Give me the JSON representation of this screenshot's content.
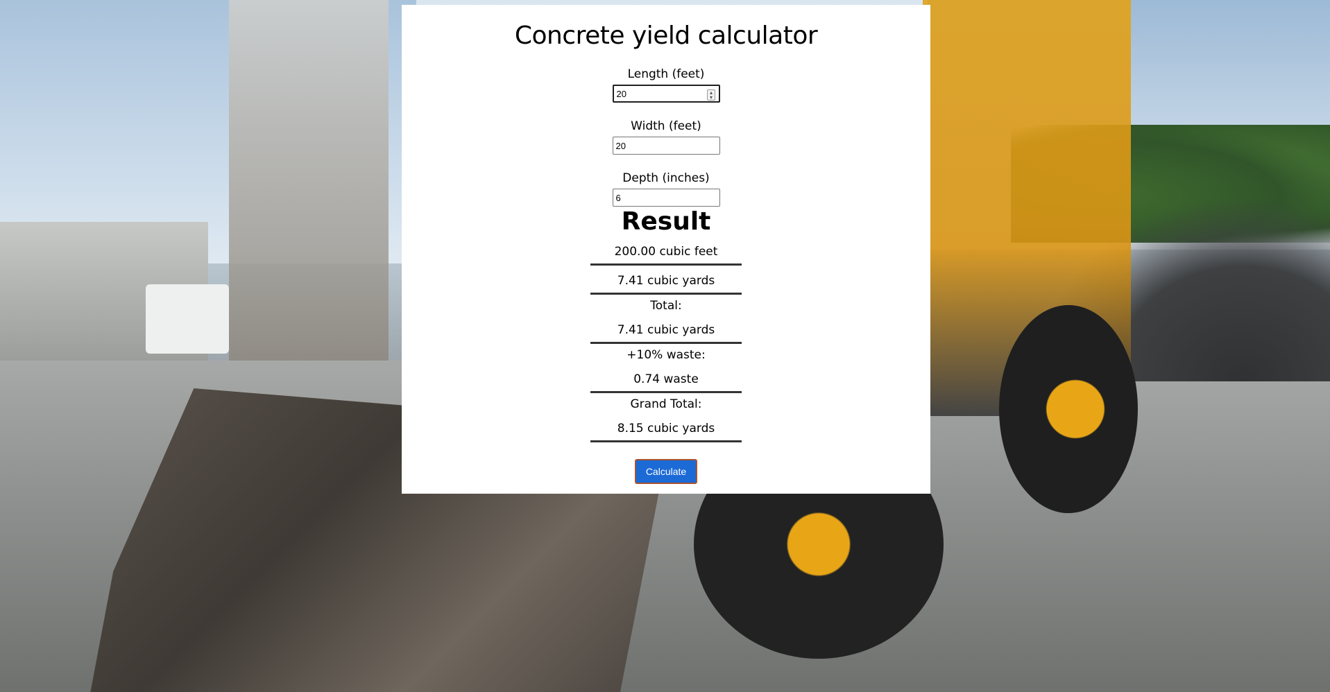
{
  "page": {
    "title": "Concrete yield calculator"
  },
  "inputs": {
    "length": {
      "label": "Length (feet)",
      "value": "20"
    },
    "width": {
      "label": "Width (feet)",
      "value": "20"
    },
    "depth": {
      "label": "Depth (inches)",
      "value": "6"
    }
  },
  "result": {
    "heading": "Result",
    "cubic_feet": "200.00 cubic feet",
    "cubic_yards": "7.41 cubic yards",
    "total_label": "Total:",
    "total_value": "7.41 cubic yards",
    "waste_label": "+10% waste:",
    "waste_value": "0.74 waste",
    "grand_total_label": "Grand Total:",
    "grand_total_value": "8.15 cubic yards"
  },
  "actions": {
    "calculate_label": "Calculate"
  },
  "colors": {
    "button_bg": "#1b6ad6",
    "card_bg": "#ffffff"
  },
  "icons": {
    "number_spinner": "spinner-icon"
  }
}
